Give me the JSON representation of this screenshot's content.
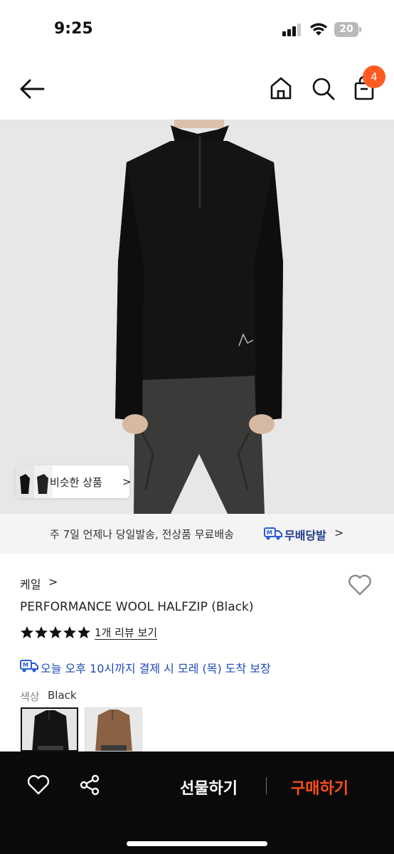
{
  "status_bar": {
    "time": "9:25",
    "battery": "20"
  },
  "nav": {
    "cart_count": "4"
  },
  "hero": {
    "similar_label": "비슷한 상품",
    "similar_chevron": ">"
  },
  "shipping": {
    "text": "주 7일 언제나 당일발송, 전상품 무료배송",
    "badge": "무배당발",
    "chevron": ">"
  },
  "product": {
    "brand": "케일",
    "brand_chevron": ">",
    "name": "PERFORMANCE WOOL HALFZIP (Black)",
    "rating_stars": 5,
    "review_link": "1개 리뷰 보기",
    "arrival": "오늘 오후 10시까지 결제 시 모레 (목) 도착 보장",
    "color_label": "색상",
    "color_value": "Black"
  },
  "bottom_bar": {
    "gift_label": "선물하기",
    "buy_label": "구매하기"
  },
  "colors": {
    "accent": "#ff5a1f",
    "buy": "#ff4e1a",
    "delivery_blue": "#1f4bb8"
  }
}
